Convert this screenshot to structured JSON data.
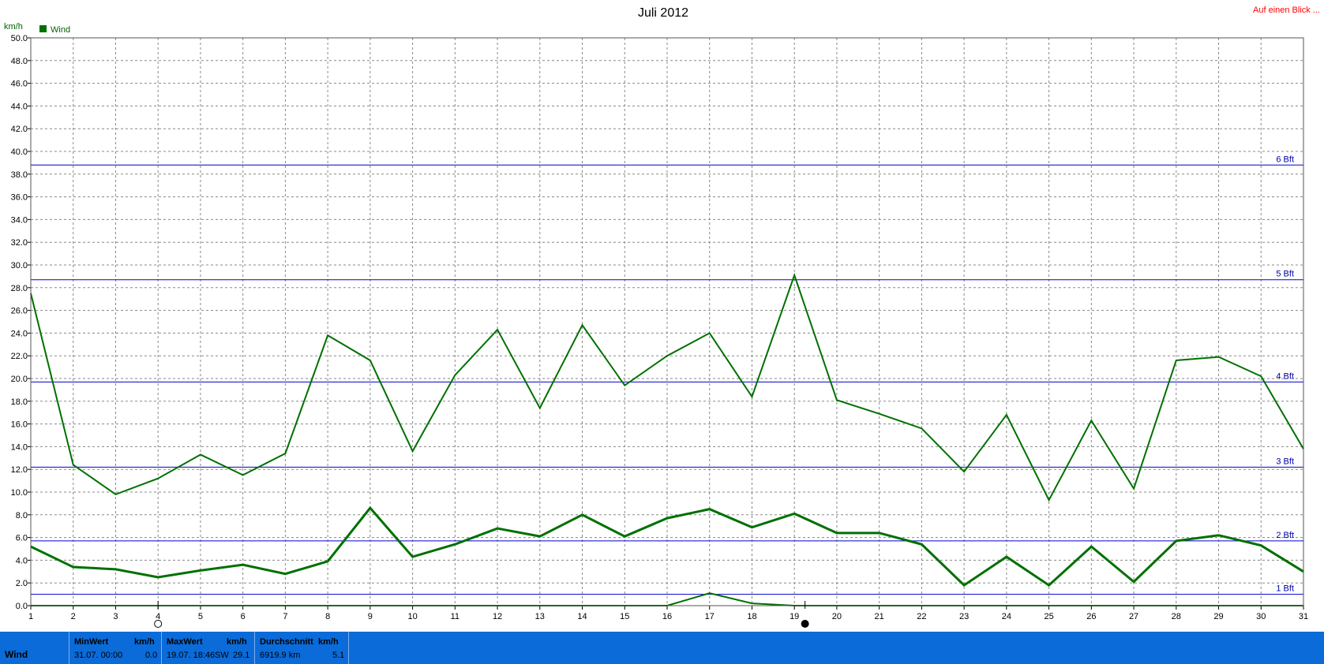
{
  "title": "Juli 2012",
  "unit_label": "km/h",
  "legend_label": "Wind",
  "link_text": "Auf einen Blick ...",
  "colors": {
    "series": "#007000",
    "bft": "#0000cc",
    "grid": "#888888",
    "statbar": "#0a6bd9"
  },
  "chart_data": {
    "type": "line",
    "title": "Juli 2012",
    "ylabel": "km/h",
    "xlabel": "",
    "x": [
      1,
      2,
      3,
      4,
      5,
      6,
      7,
      8,
      9,
      10,
      11,
      12,
      13,
      14,
      15,
      16,
      17,
      18,
      19,
      20,
      21,
      22,
      23,
      24,
      25,
      26,
      27,
      28,
      29,
      30,
      31
    ],
    "ylim": [
      0,
      50
    ],
    "xlim": [
      1,
      31
    ],
    "yticks": [
      "0.0",
      "2.0",
      "4.0",
      "6.0",
      "8.0",
      "10.0",
      "12.0",
      "14.0",
      "16.0",
      "18.0",
      "20.0",
      "22.0",
      "24.0",
      "26.0",
      "28.0",
      "30.0",
      "32.0",
      "34.0",
      "36.0",
      "38.0",
      "40.0",
      "42.0",
      "44.0",
      "46.0",
      "48.0",
      "50.0"
    ],
    "xticks": [
      "1",
      "2",
      "3",
      "4",
      "5",
      "6",
      "7",
      "8",
      "9",
      "10",
      "11",
      "12",
      "13",
      "14",
      "15",
      "16",
      "17",
      "18",
      "19",
      "20",
      "21",
      "22",
      "23",
      "24",
      "25",
      "26",
      "27",
      "28",
      "29",
      "30",
      "31"
    ],
    "grid": true,
    "legend": "top-left",
    "series": [
      {
        "name": "Wind",
        "style": "max",
        "width": 2,
        "values": [
          27.5,
          12.4,
          9.8,
          11.2,
          13.3,
          11.5,
          13.4,
          23.8,
          21.6,
          13.6,
          20.3,
          24.3,
          17.4,
          24.7,
          19.4,
          22.0,
          24.0,
          18.4,
          29.1,
          18.1,
          16.9,
          15.6,
          11.8,
          16.8,
          9.3,
          16.3,
          10.3,
          21.6,
          21.9,
          20.2,
          13.8
        ]
      },
      {
        "name": "Wind",
        "style": "avg",
        "width": 3,
        "values": [
          5.2,
          3.4,
          3.2,
          2.5,
          3.1,
          3.6,
          2.8,
          3.9,
          8.6,
          4.3,
          5.4,
          6.8,
          6.1,
          8.0,
          6.1,
          7.7,
          8.5,
          6.9,
          8.1,
          6.4,
          6.4,
          5.4,
          1.8,
          4.3,
          1.8,
          5.2,
          2.1,
          5.7,
          6.2,
          5.3,
          3.0
        ]
      },
      {
        "name": "Wind",
        "style": "min",
        "width": 2,
        "values": [
          0,
          0,
          0,
          0,
          0,
          0,
          0,
          0,
          0,
          0,
          0,
          0,
          0,
          0,
          0,
          0,
          1.1,
          0.2,
          0,
          0,
          0,
          0,
          0,
          0,
          0,
          0,
          0,
          0,
          0,
          0,
          0
        ]
      }
    ],
    "reference_lines": [
      {
        "label": "1 Bft",
        "value": 1.0
      },
      {
        "label": "2 Bft",
        "value": 5.7
      },
      {
        "label": "3 Bft",
        "value": 12.2
      },
      {
        "label": "4 Bft",
        "value": 19.7
      },
      {
        "label": "5 Bft",
        "value": 28.7
      },
      {
        "label": "6 Bft",
        "value": 38.8
      }
    ],
    "moon_markers": [
      {
        "phase": "new-moon",
        "day": 4
      },
      {
        "phase": "full-moon",
        "day": 19.25
      }
    ]
  },
  "stats": {
    "row_label": "Wind",
    "min": {
      "header": "MinWert",
      "unit": "km/h",
      "date": "31.07.  00:00",
      "value": "0.0"
    },
    "max": {
      "header": "MaxWert",
      "unit": "km/h",
      "date": "19.07.  18:46",
      "dir": "SW",
      "value": "29.1"
    },
    "avg": {
      "header": "Durchschnitt",
      "unit": "km/h",
      "total": "6919.9 km",
      "value": "5.1"
    }
  }
}
